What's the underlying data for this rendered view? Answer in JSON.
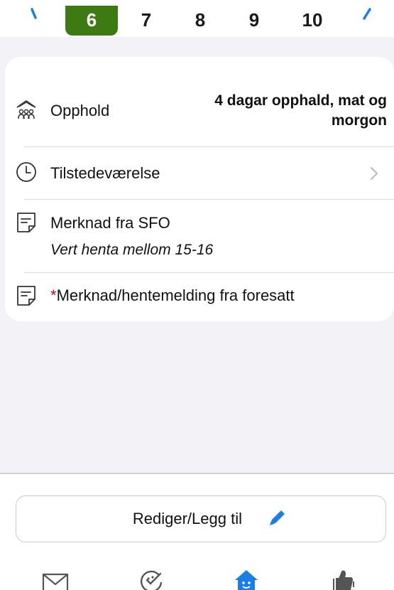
{
  "date_strip": {
    "days": [
      "6",
      "7",
      "8",
      "9",
      "10"
    ],
    "selected_day": "6"
  },
  "details": {
    "stay": {
      "label": "Opphold",
      "value": "4 dagar opphald, mat og morgon"
    },
    "attendance": {
      "label": "Tilstedeværelse"
    },
    "sfo_note": {
      "label": "Merknad fra SFO",
      "text": "Vert henta mellom 15-16"
    },
    "guardian_note": {
      "required_mark": "*",
      "label": "Merknad/hentemelding fra foresatt"
    }
  },
  "edit_button": {
    "label": "Rediger/Legg til"
  },
  "tab_bar": {
    "icons": [
      "mail-icon",
      "check-badge-icon",
      "home-icon",
      "thumbs-up-icon"
    ],
    "active_color": "#1a7ee8"
  },
  "colors": {
    "accent": "#1a7ee8",
    "selected_day": "#3d7a12",
    "required": "#d0021b"
  }
}
